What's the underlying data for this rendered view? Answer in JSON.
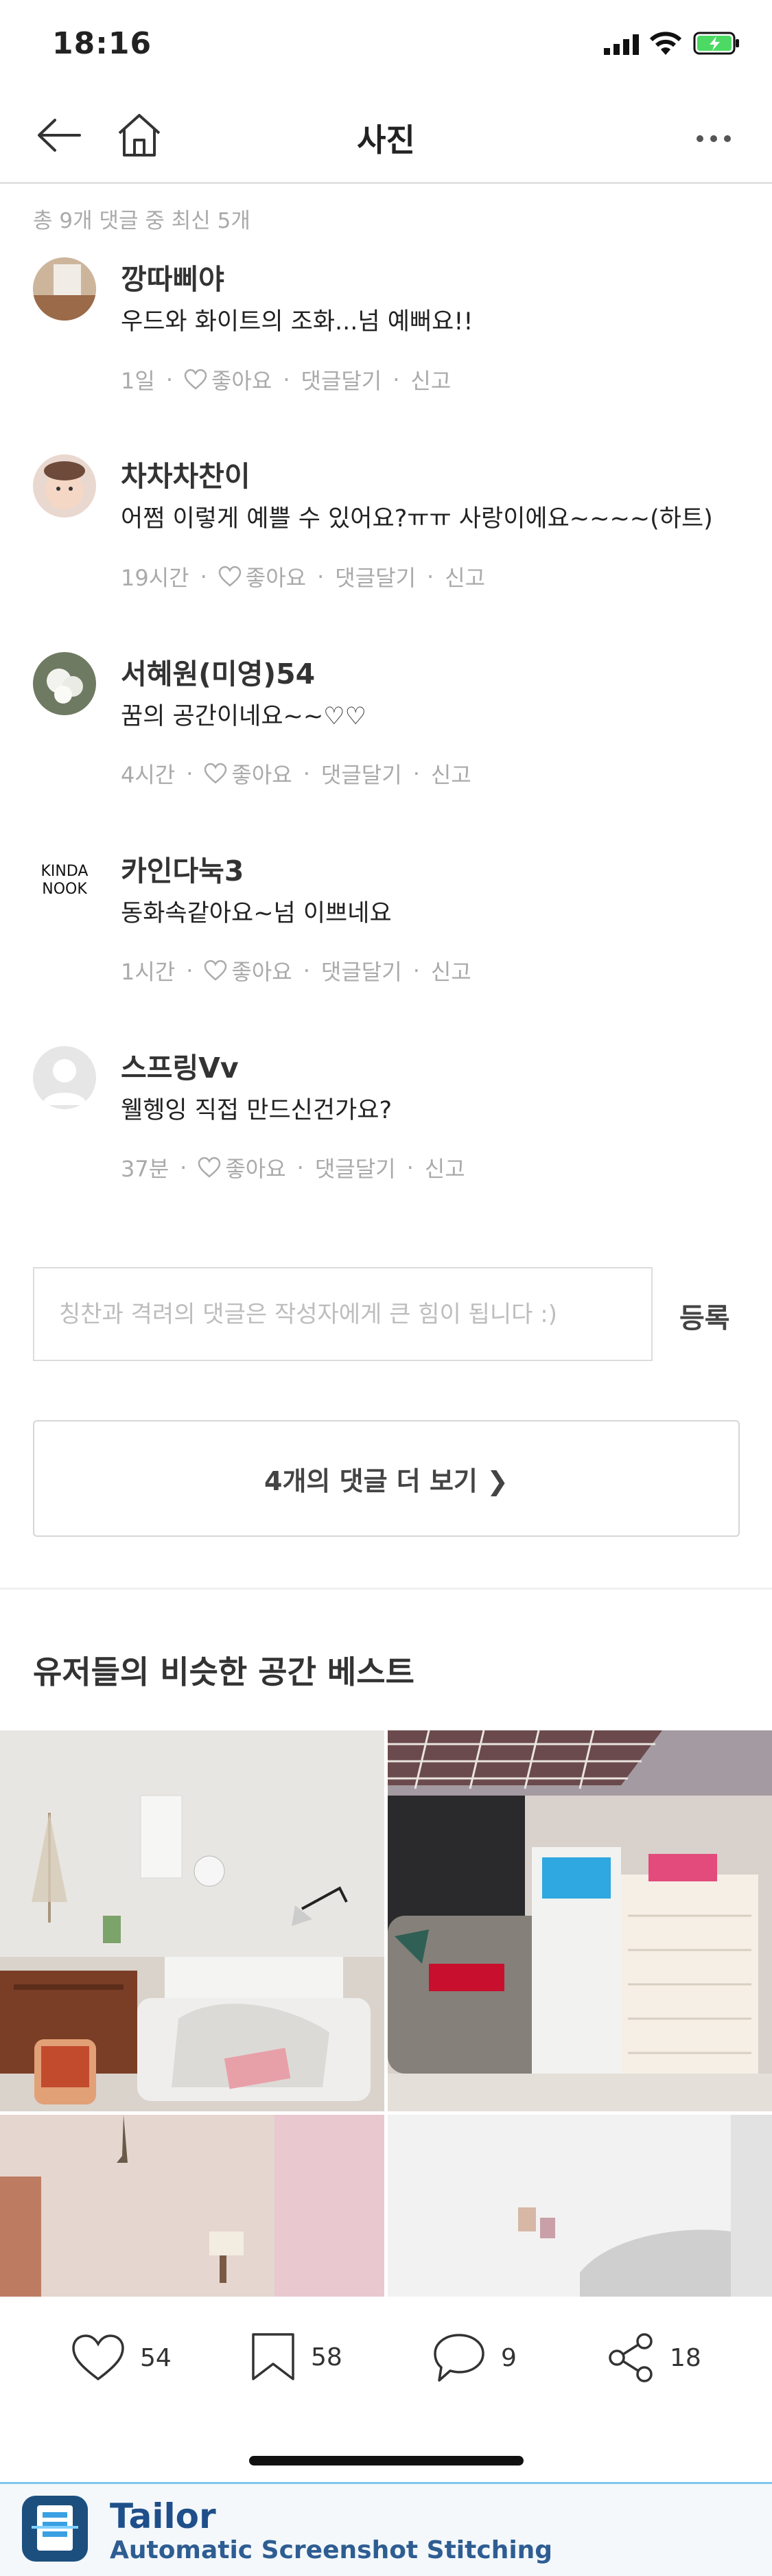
{
  "status_bar": {
    "time": "18:16"
  },
  "nav": {
    "title": "사진"
  },
  "comments_summary": "총 9개 댓글 중 최신 5개",
  "comments": [
    {
      "name": "깡따삐야",
      "text": "우드와 화이트의 조화...넘 예뻐요!!",
      "time": "1일",
      "like": "좋아요",
      "reply": "댓글달기",
      "report": "신고"
    },
    {
      "name": "차차차찬이",
      "text": "어쩜 이렇게 예쁠 수 있어요?ㅠㅠ 사랑이에요~~~~(하트)",
      "time": "19시간",
      "like": "좋아요",
      "reply": "댓글달기",
      "report": "신고"
    },
    {
      "name": "서혜원(미영)54",
      "text": "꿈의 공간이네요~~♡♡",
      "time": "4시간",
      "like": "좋아요",
      "reply": "댓글달기",
      "report": "신고"
    },
    {
      "name": "카인다눅3",
      "text": "동화속같아요~넘 이쁘네요",
      "time": "1시간",
      "like": "좋아요",
      "reply": "댓글달기",
      "report": "신고",
      "avatar_text": [
        "KINDA",
        "NOOK"
      ]
    },
    {
      "name": "스프링Vv",
      "text": "웰헹잉 직접 만드신건가요?",
      "time": "37분",
      "like": "좋아요",
      "reply": "댓글달기",
      "report": "신고"
    }
  ],
  "comment_input": {
    "placeholder": "칭찬과 격려의 댓글은 작성자에게 큰 힘이 됩니다 :)"
  },
  "submit_label": "등록",
  "more_comments_label": "4개의 댓글 더 보기 ❯",
  "similar_section_title": "유저들의 비슷한 공간 베스트",
  "actions": {
    "likes": "54",
    "bookmarks": "58",
    "comments": "9",
    "shares": "18"
  },
  "banner": {
    "title": "Tailor",
    "subtitle": "Automatic Screenshot Stitching"
  },
  "colors": {
    "accent_banner": "#1f4f8a",
    "battery": "#4cd964"
  },
  "icons": [
    "back-arrow-icon",
    "home-icon",
    "more-icon",
    "heart-icon",
    "bookmark-icon",
    "comment-icon",
    "share-icon"
  ]
}
